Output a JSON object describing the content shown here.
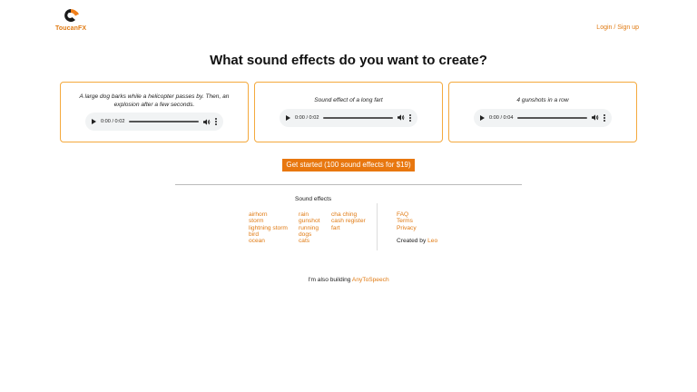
{
  "brand": {
    "name": "ToucanFX",
    "accent": "#e07a12",
    "card_border": "#f4a93d",
    "cta_bg": "#e8770f"
  },
  "header": {
    "login_label": "Login / Sign up"
  },
  "main": {
    "heading": "What sound effects do you want to create?",
    "examples": [
      {
        "description": "A large dog barks while a helicopter passes by. Then, an explosion after a few seconds.",
        "player_time": "0:00 / 0:02"
      },
      {
        "description": "Sound effect of a long fart",
        "player_time": "0:00 / 0:02"
      },
      {
        "description": "4 gunshots in a row",
        "player_time": "0:00 / 0:04"
      }
    ],
    "cta_label": "Get started (100 sound effects for $19)"
  },
  "footer": {
    "sound_effects_heading": "Sound effects",
    "col1": [
      "airhorn",
      "storm",
      "lightning storm",
      "bird",
      "ocean"
    ],
    "col2": [
      "rain",
      "gunshot",
      "running",
      "dogs",
      "cats"
    ],
    "col3": [
      "cha ching",
      "cash register",
      "fart"
    ],
    "links": [
      "FAQ",
      "Terms",
      "Privacy"
    ],
    "created_by_text": "Created by",
    "created_by_name": "Leo",
    "building_text": "I'm also building",
    "building_link": "AnyToSpeech"
  },
  "icons": {
    "logo": "toucan-logo-icon",
    "play": "play-icon",
    "volume": "volume-icon",
    "more": "more-options-icon"
  }
}
